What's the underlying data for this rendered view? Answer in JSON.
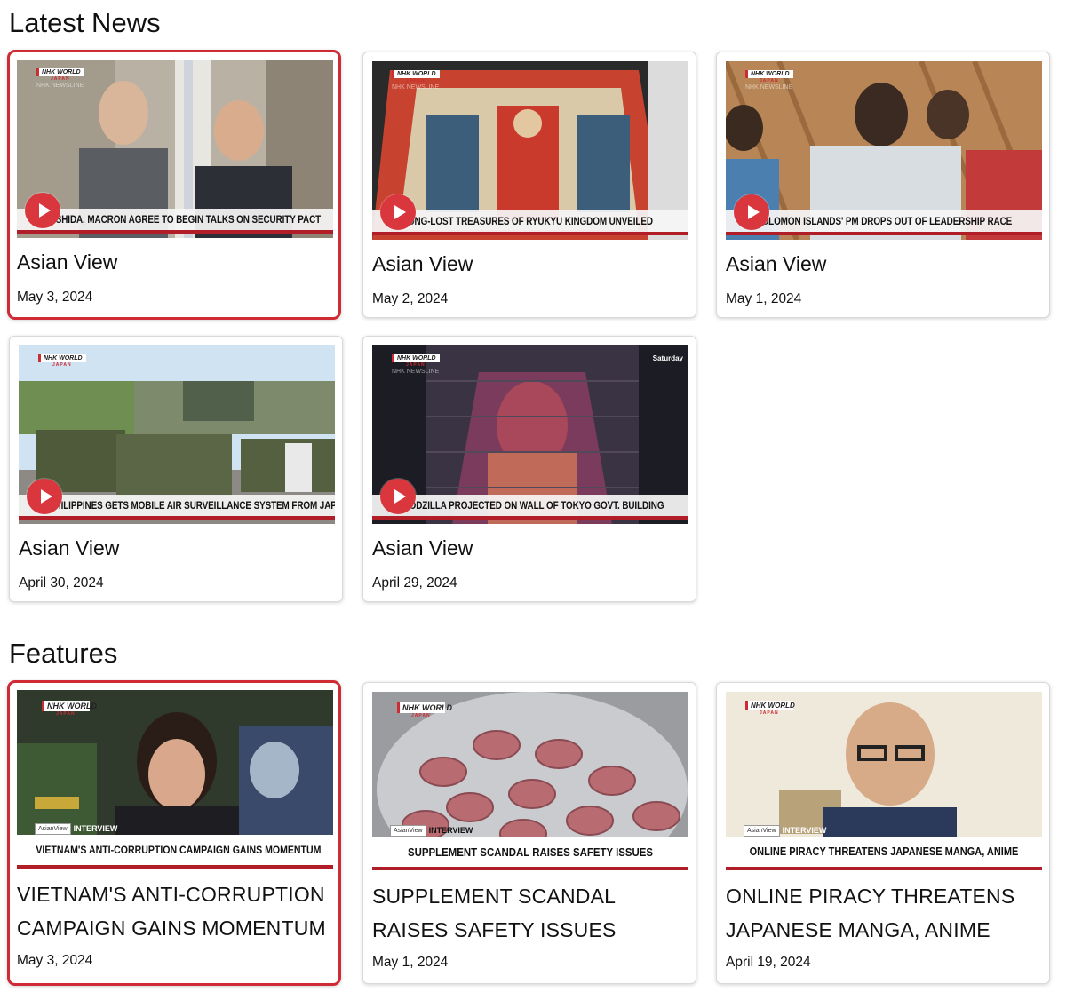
{
  "sections": {
    "latest_news": "Latest News",
    "features": "Features"
  },
  "branding": {
    "logo_line1": "NHK WORLD",
    "logo_line2": "JAPAN",
    "logo_line3": "NHK NEWSLINE",
    "asian_view_badge": "AsianView",
    "interview_label": "INTERVIEW",
    "accent_color": "#cf2b35"
  },
  "latest_news": [
    {
      "caption": "KISHIDA, MACRON AGREE TO BEGIN TALKS ON SECURITY PACT",
      "title": "Asian View",
      "date": "May 3, 2024",
      "selected": true
    },
    {
      "caption": "LONG-LOST TREASURES OF RYUKYU KINGDOM UNVEILED",
      "title": "Asian View",
      "date": "May 2, 2024"
    },
    {
      "caption": "SOLOMON ISLANDS' PM DROPS OUT OF LEADERSHIP RACE",
      "title": "Asian View",
      "date": "May 1, 2024"
    },
    {
      "caption": "PHILIPPINES GETS MOBILE AIR SURVEILLANCE SYSTEM FROM JAPAN",
      "title": "Asian View",
      "date": "April 30, 2024"
    },
    {
      "caption": "GODZILLA PROJECTED ON WALL OF TOKYO GOVT. BUILDING",
      "title": "Asian View",
      "date": "April 29, 2024",
      "tag": "Saturday"
    }
  ],
  "features": [
    {
      "caption": "VIETNAM'S ANTI-CORRUPTION CAMPAIGN GAINS MOMENTUM",
      "title_line1": "VIETNAM'S ANTI-CORRUPTION",
      "title_line2": "CAMPAIGN GAINS MOMENTUM",
      "date": "May 3, 2024",
      "selected": true
    },
    {
      "caption": "SUPPLEMENT SCANDAL RAISES SAFETY ISSUES",
      "title_line1": "SUPPLEMENT SCANDAL",
      "title_line2": "RAISES SAFETY ISSUES",
      "date": "May 1, 2024"
    },
    {
      "caption": "ONLINE PIRACY THREATENS JAPANESE MANGA, ANIME",
      "title_line1": "ONLINE PIRACY THREATENS",
      "title_line2": "JAPANESE MANGA, ANIME",
      "date": "April 19, 2024"
    }
  ]
}
